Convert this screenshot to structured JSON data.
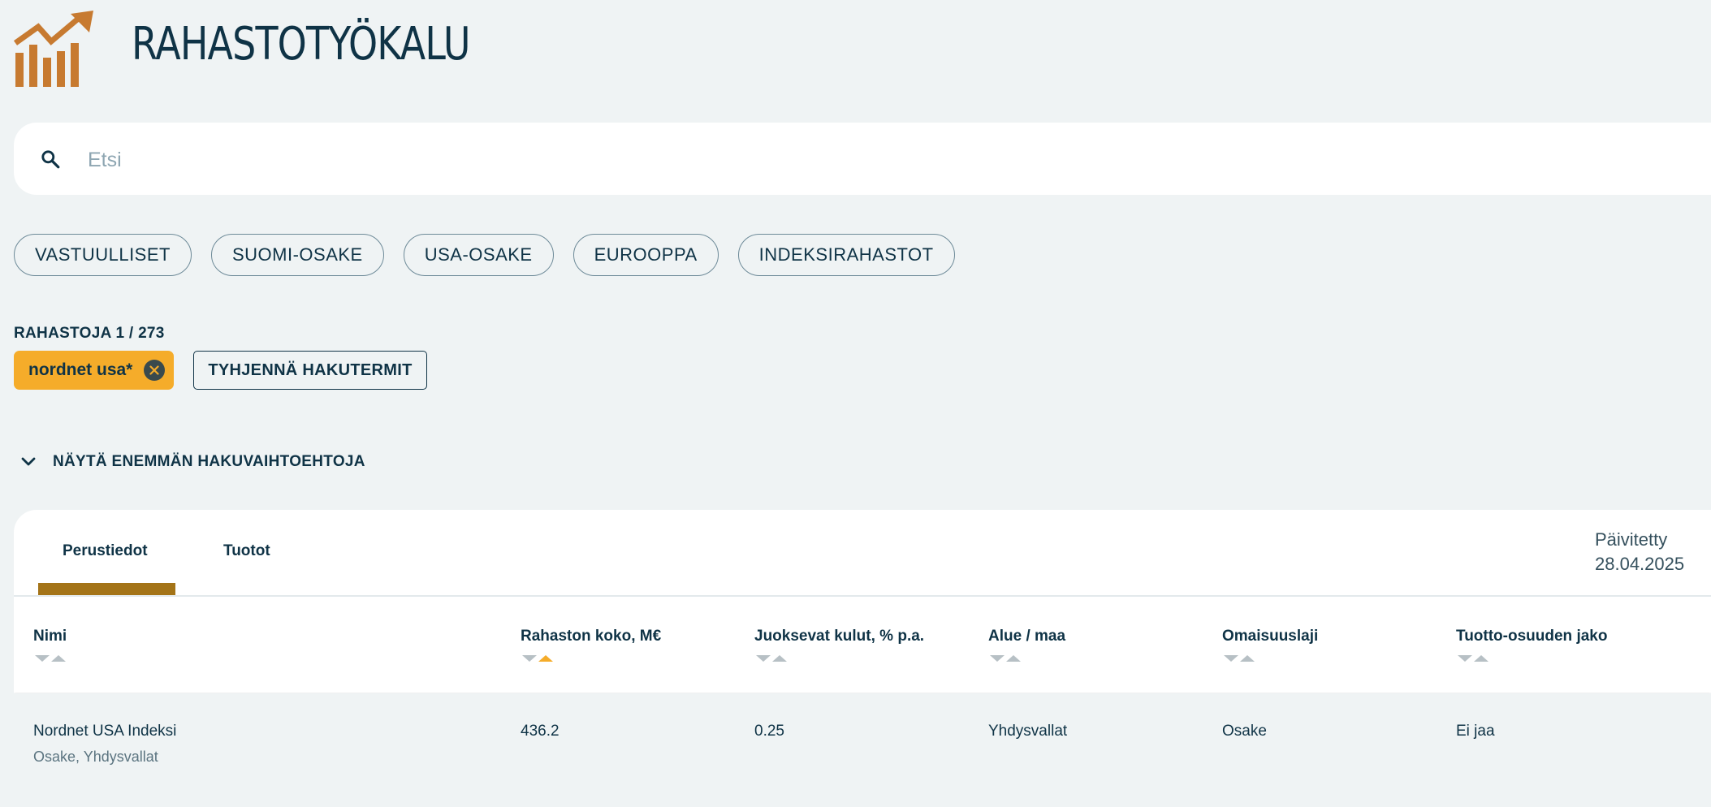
{
  "app": {
    "title": "RAHASTOTYÖKALU",
    "logo_icon": "chart-growth-logo",
    "accent_color": "#c77a30"
  },
  "search": {
    "placeholder": "Etsi",
    "value": "",
    "icon": "search-icon"
  },
  "quick_filters": [
    "VASTUULLISET",
    "SUOMI-OSAKE",
    "USA-OSAKE",
    "EUROOPPA",
    "INDEKSIRAHASTOT"
  ],
  "results": {
    "count_label": "RAHASTOJA 1 / 273",
    "active_term": "nordnet usa*",
    "active_term_color": "#f5ac2a",
    "clear_label": "TYHJENNÄ HAKUTERMIT"
  },
  "more_options": {
    "label": "NÄYTÄ ENEMMÄN HAKUVAIHTOEHTOJA",
    "icon": "chevron-down-icon"
  },
  "table": {
    "tabs": [
      "Perustiedot",
      "Tuotot"
    ],
    "active_tab": "Perustiedot",
    "updated_label": "Päivitetty",
    "updated_date": "28.04.2025",
    "columns": [
      "Nimi",
      "Rahaston koko, M€",
      "Juoksevat kulut, % p.a.",
      "Alue / maa",
      "Omaisuuslaji",
      "Tuotto-osuuden jako"
    ],
    "active_sort": {
      "column": "Rahaston koko, M€",
      "direction": "ascending"
    },
    "rows": [
      {
        "name": "Nordnet USA Indeksi",
        "subtitle": "Osake, Yhdysvallat",
        "size": "436.2",
        "costs": "0.25",
        "region": "Yhdysvallat",
        "asset_class": "Osake",
        "distribution": "Ei jaa"
      }
    ]
  }
}
